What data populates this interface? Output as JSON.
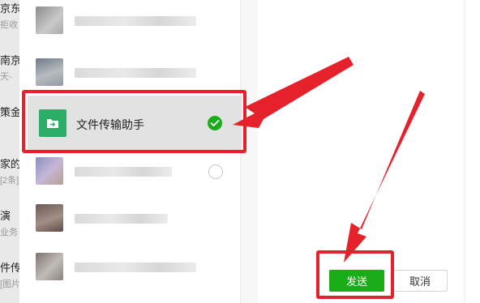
{
  "background_chats": [
    {
      "name": "京东",
      "sub": "拒收"
    },
    {
      "name": "南京",
      "sub": "天-"
    },
    {
      "name": "策金",
      "sub": ""
    },
    {
      "name": "家的",
      "sub": "[2条]"
    },
    {
      "name": "演",
      "sub": "业务"
    },
    {
      "name": "件传",
      "sub": "[图片]"
    }
  ],
  "contact_list": {
    "selected_contact": {
      "name": "文件传输助手",
      "avatar_icon": "folder-share-icon",
      "checked": true
    },
    "blurred_rows": 6
  },
  "footer": {
    "send_label": "发送",
    "cancel_label": "取消"
  },
  "colors": {
    "accent_green": "#1aad19",
    "avatar_green": "#2aae67",
    "annotation_red": "#e5222b"
  }
}
